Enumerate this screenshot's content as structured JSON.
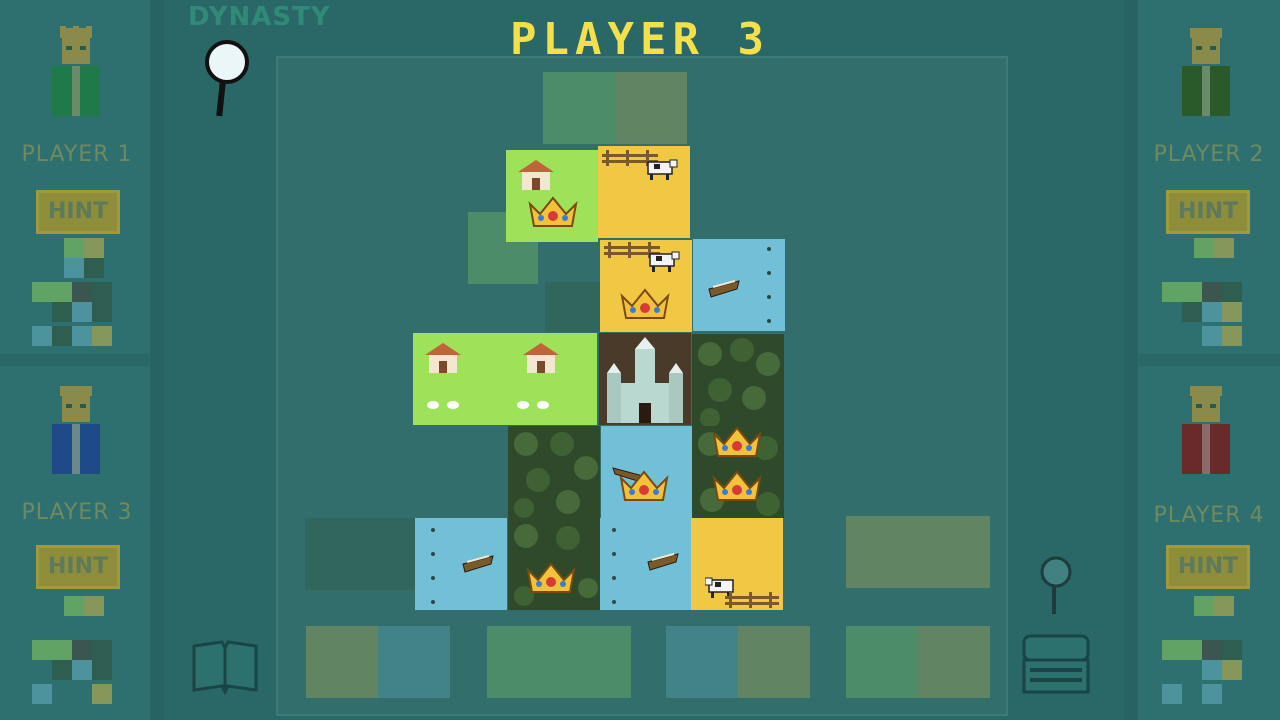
{
  "header": {
    "brand": "DYNASTY",
    "current_player": "PLAYER 3"
  },
  "players": [
    {
      "label": "PLAYER 1",
      "hint": "HINT",
      "robe_color": "#1f7a4a"
    },
    {
      "label": "PLAYER 2",
      "hint": "HINT",
      "robe_color": "#2a5a2a"
    },
    {
      "label": "PLAYER 3",
      "hint": "HINT",
      "robe_color": "#1f4a8a"
    },
    {
      "label": "PLAYER 4",
      "hint": "HINT",
      "robe_color": "#6a2a2a"
    }
  ],
  "colors": {
    "wheat": "#f0c843",
    "grass": "#9ee25a",
    "water": "#72bfd8",
    "forest": "#2f4a2a",
    "title": "#f4e04a"
  },
  "icons": [
    "magnifier-icon",
    "book-icon",
    "treasure-chest-icon",
    "crown-icon",
    "castle-icon",
    "house-icon",
    "cow-icon",
    "fence-icon"
  ]
}
